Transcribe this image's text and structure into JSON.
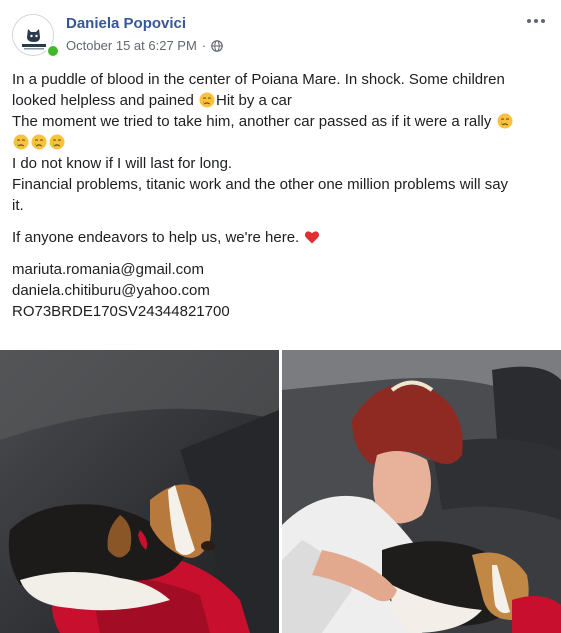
{
  "post": {
    "author": "Daniela Popovici",
    "date": "October 15 at 6:27 PM",
    "separator": "·",
    "privacy_icon": "globe-icon",
    "avatar_icon": "mariuta-logo-icon",
    "more_icon": "more-options-icon",
    "lines": [
      "In a puddle of blood in the center of Poiana Mare. In shock. Some children",
      "looked helpless and pained ",
      "Hit by a car",
      "The moment we tried to take him, another car passed as if it were a rally ",
      "I do not know if I will last for long.",
      "Financial problems, titanic work and the other one million problems will say",
      "it.",
      "If anyone endeavors to help us, we're here. "
    ],
    "contacts": [
      "mariuta.romania@gmail.com",
      "daniela.chitiburu@yahoo.com",
      "RO73BRDE170SV24344821700"
    ],
    "emoji_sad": "sad-face-emoji",
    "emoji_heart": "red-heart-emoji"
  },
  "photos": [
    {
      "name": "injured-dog-photo"
    },
    {
      "name": "woman-with-dog-in-car-photo"
    }
  ],
  "colors": {
    "author": "#365899",
    "meta": "#616770",
    "text": "#1c1e21",
    "online": "#42b72a",
    "heart": "#e02f33"
  }
}
